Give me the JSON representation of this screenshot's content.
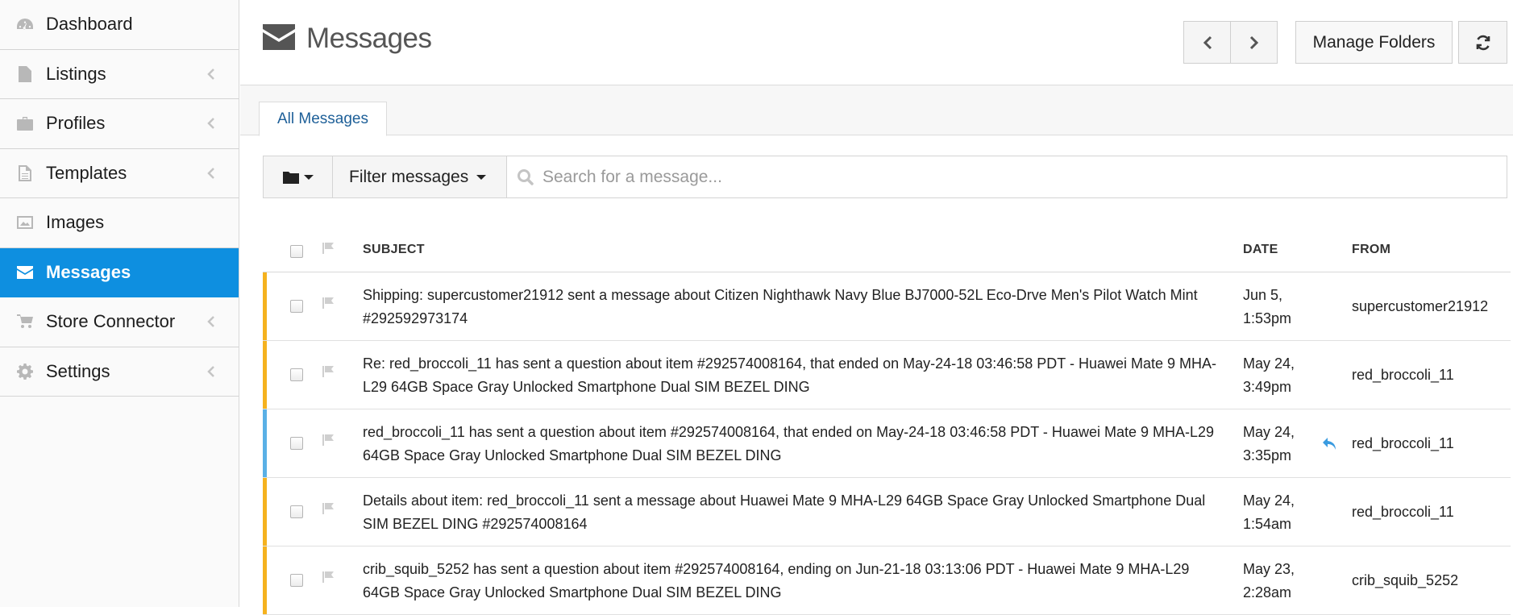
{
  "sidebar": {
    "items": [
      {
        "label": "Dashboard",
        "icon": "dashboard-icon",
        "has_chevron": false,
        "active": false
      },
      {
        "label": "Listings",
        "icon": "file-icon",
        "has_chevron": true,
        "active": false
      },
      {
        "label": "Profiles",
        "icon": "briefcase-icon",
        "has_chevron": true,
        "active": false
      },
      {
        "label": "Templates",
        "icon": "document-icon",
        "has_chevron": true,
        "active": false
      },
      {
        "label": "Images",
        "icon": "image-icon",
        "has_chevron": false,
        "active": false
      },
      {
        "label": "Messages",
        "icon": "envelope-icon",
        "has_chevron": false,
        "active": true
      },
      {
        "label": "Store Connector",
        "icon": "cart-icon",
        "has_chevron": true,
        "active": false
      },
      {
        "label": "Settings",
        "icon": "gear-icon",
        "has_chevron": true,
        "active": false
      }
    ]
  },
  "header": {
    "title": "Messages",
    "manage_folders_label": "Manage Folders"
  },
  "tabs": [
    {
      "label": "All Messages",
      "active": true
    }
  ],
  "toolbar": {
    "filter_label": "Filter messages",
    "search_placeholder": "Search for a message..."
  },
  "table": {
    "columns": {
      "subject": "SUBJECT",
      "date": "DATE",
      "from": "FROM"
    },
    "rows": [
      {
        "stripe": "#f5b21e",
        "subject": "Shipping: supercustomer21912 sent a message about Citizen Nighthawk Navy Blue BJ7000-52L Eco-Drve Men's Pilot Watch Mint #292592973174",
        "date": "Jun 5, 1:53pm",
        "replied": false,
        "from": "supercustomer21912"
      },
      {
        "stripe": "#f5b21e",
        "subject": "Re: red_broccoli_11 has sent a question about item #292574008164, that ended on May-24-18 03:46:58 PDT - Huawei Mate 9 MHA-L29 64GB Space Gray Unlocked Smartphone Dual SIM BEZEL DING",
        "date": "May 24, 3:49pm",
        "replied": false,
        "from": "red_broccoli_11"
      },
      {
        "stripe": "#5ab0e6",
        "subject": "red_broccoli_11 has sent a question about item #292574008164, that ended on May-24-18 03:46:58 PDT - Huawei Mate 9 MHA-L29 64GB Space Gray Unlocked Smartphone Dual SIM BEZEL DING",
        "date": "May 24, 3:35pm",
        "replied": true,
        "from": "red_broccoli_11"
      },
      {
        "stripe": "#f5b21e",
        "subject": "Details about item: red_broccoli_11 sent a message about Huawei Mate 9 MHA-L29 64GB Space Gray Unlocked Smartphone Dual SIM BEZEL DING #292574008164",
        "date": "May 24, 1:54am",
        "replied": false,
        "from": "red_broccoli_11"
      },
      {
        "stripe": "#f5b21e",
        "subject": "crib_squib_5252 has sent a question about item #292574008164, ending on Jun-21-18 03:13:06 PDT - Huawei Mate 9 MHA-L29 64GB Space Gray Unlocked Smartphone Dual SIM BEZEL DING",
        "date": "May 23, 2:28am",
        "replied": false,
        "from": "crib_squib_5252"
      }
    ]
  },
  "colors": {
    "accent": "#0e8fe0",
    "unread_stripe": "#f5b21e",
    "read_stripe": "#5ab0e6"
  }
}
